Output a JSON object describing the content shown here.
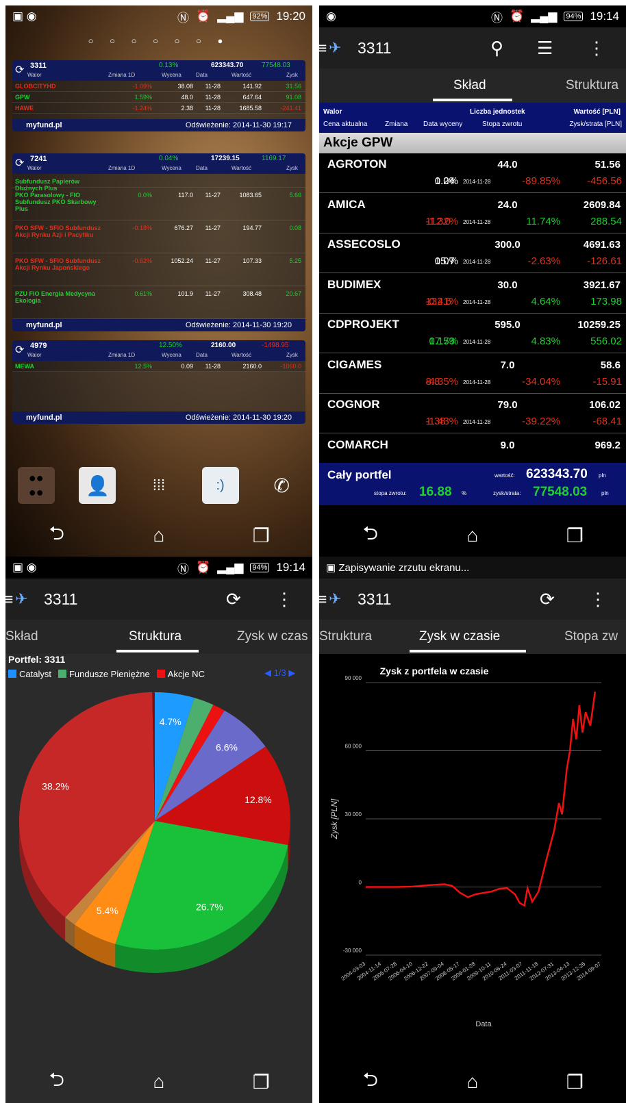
{
  "s1": {
    "status_time": "19:20",
    "battery": "92%",
    "page_dots": "○ ○ ○ ○ ○ ○ ●",
    "widgets": [
      {
        "id": "3311",
        "change": "0.13%",
        "value": "623343.70",
        "profit": "77548.03",
        "headers": [
          "Walor",
          "Zmiana 1D",
          "Wycena",
          "Data",
          "Wartość",
          "Zysk"
        ],
        "rows": [
          {
            "name": "GLOBCITYHD",
            "chg": "-1.09%",
            "val": "38.08",
            "date": "11-28",
            "worth": "141.92",
            "gain": "31.56",
            "nc": "rd",
            "cc": "rd",
            "gc": "g"
          },
          {
            "name": "GPW",
            "chg": "1.59%",
            "val": "48.0",
            "date": "11-28",
            "worth": "647.64",
            "gain": "91.08",
            "nc": "g",
            "cc": "g",
            "gc": "g"
          },
          {
            "name": "HAWE",
            "chg": "-1.24%",
            "val": "2.38",
            "date": "11-28",
            "worth": "1685.58",
            "gain": "-241.41",
            "nc": "rd",
            "cc": "rd",
            "gc": "rd"
          }
        ],
        "footer_brand": "myfund.pl",
        "footer_refresh": "Odświeżenie: 2014-11-30 19:17"
      },
      {
        "id": "7241",
        "change": "0.04%",
        "value": "17239.15",
        "profit": "1169.17",
        "headers": [
          "Walor",
          "Zmiana 1D",
          "Wycena",
          "Data",
          "Wartość",
          "Zysk"
        ],
        "rows": [
          {
            "name": "Subfundusz Papierów Dłużnych Plus",
            "chg": "",
            "val": "",
            "date": "",
            "worth": "",
            "gain": "",
            "nc": "g",
            "cc": "g",
            "gc": "g"
          },
          {
            "name": "PKO Parasolowy - FIO Subfundusz PKO Skarbowy Plus",
            "chg": "0.0%",
            "val": "117.0",
            "date": "11-27",
            "worth": "1083.65",
            "gain": "5.66",
            "nc": "g",
            "cc": "g",
            "gc": "g"
          },
          {
            "name": "PKO SFW - SFIO Subfundusz Akcji Rynku Azji i Pacyfiku",
            "chg": "-0.18%",
            "val": "676.27",
            "date": "11-27",
            "worth": "194.77",
            "gain": "0.08",
            "nc": "rd",
            "cc": "rd",
            "gc": "g"
          },
          {
            "name": "PKO SFW - SFIO Subfundusz Akcji Rynku Japońskiego",
            "chg": "-0.62%",
            "val": "1052.24",
            "date": "11-27",
            "worth": "107.33",
            "gain": "5.25",
            "nc": "rd",
            "cc": "rd",
            "gc": "g"
          },
          {
            "name": "PZU FIO Energia Medycyna Ekologia",
            "chg": "0.61%",
            "val": "101.9",
            "date": "11-27",
            "worth": "308.48",
            "gain": "20.67",
            "nc": "g",
            "cc": "g",
            "gc": "g"
          }
        ],
        "footer_brand": "myfund.pl",
        "footer_refresh": "Odświeżenie: 2014-11-30 19:20"
      },
      {
        "id": "4979",
        "change": "12.50%",
        "value": "2160.00",
        "profit": "-1498.95",
        "headers": [
          "Walor",
          "Zmiana 1D",
          "Wycena",
          "Data",
          "Wartość",
          "Zysk"
        ],
        "rows": [
          {
            "name": "MEWA",
            "chg": "12.5%",
            "val": "0.09",
            "date": "11-28",
            "worth": "2160.0",
            "gain": "-1060.0",
            "nc": "g",
            "cc": "g",
            "gc": "rd"
          }
        ],
        "footer_brand": "myfund.pl",
        "footer_refresh": "Odświeżenie: 2014-11-30 19:20"
      }
    ]
  },
  "s2": {
    "status_time": "19:14",
    "battery": "94%",
    "title": "3311",
    "tabs": [
      "Skład",
      "Struktura"
    ],
    "header": {
      "walor": "Walor",
      "units": "Liczba jednostek",
      "worth": "Wartość [PLN]",
      "price": "Cena aktualna",
      "chg": "Zmiana",
      "date": "Data wyceny",
      "rate": "Stopa zwrotu",
      "pl": "Zysk/strata [PLN]"
    },
    "group": "Akcje GPW",
    "rows": [
      {
        "name": "AGROTON",
        "qty": "44.0",
        "worth": "51.56",
        "price": "1.24",
        "chg": "0.0%",
        "date": "2014-11-28",
        "rate": "-89.85%",
        "pl": "-456.56",
        "pc": "wh",
        "rc": "rd"
      },
      {
        "name": "AMICA",
        "qty": "24.0",
        "worth": "2609.84",
        "price": "112.0",
        "chg": "-1.32%",
        "date": "2014-11-28",
        "rate": "11.74%",
        "pl": "288.54",
        "pc": "rd",
        "rc": "g"
      },
      {
        "name": "ASSECOSLO",
        "qty": "300.0",
        "worth": "4691.63",
        "price": "15.7",
        "chg": "0.0%",
        "date": "2014-11-28",
        "rate": "-2.63%",
        "pl": "-126.61",
        "pc": "wh",
        "rc": "rd"
      },
      {
        "name": "BUDIMEX",
        "qty": "30.0",
        "worth": "3921.67",
        "price": "132.6",
        "chg": "-0.41%",
        "date": "2014-11-28",
        "rate": "4.64%",
        "pl": "173.98",
        "pc": "rd",
        "rc": "g"
      },
      {
        "name": "CDPROJEKT",
        "qty": "595.0",
        "worth": "10259.25",
        "price": "17.53",
        "chg": "0.17%",
        "date": "2014-11-28",
        "rate": "4.83%",
        "pl": "556.02",
        "pc": "g",
        "rc": "g"
      },
      {
        "name": "CIGAMES",
        "qty": "7.0",
        "worth": "58.6",
        "price": "8.8",
        "chg": "-4.35%",
        "date": "2014-11-28",
        "rate": "-34.04%",
        "pl": "-15.91",
        "pc": "rd",
        "rc": "rd"
      },
      {
        "name": "COGNOR",
        "qty": "79.0",
        "worth": "106.02",
        "price": "1.38",
        "chg": "-1.43%",
        "date": "2014-11-28",
        "rate": "-39.22%",
        "pl": "-68.41",
        "pc": "rd",
        "rc": "rd"
      },
      {
        "name": "COMARCH",
        "qty": "9.0",
        "worth": "969.2",
        "price": "",
        "chg": "",
        "date": "",
        "rate": "",
        "pl": "",
        "pc": "rd",
        "rc": "rd"
      }
    ],
    "total": {
      "label": "Cały portfel",
      "worth_label": "wartość:",
      "worth": "623343.70",
      "unit": "pln",
      "rate_label": "stopa zwrotu:",
      "rate": "16.88",
      "rate_unit": "%",
      "pl_label": "zysk/strata:",
      "pl": "77548.03",
      "pl_unit": "pln"
    }
  },
  "s3": {
    "status_time": "19:14",
    "battery": "94%",
    "title": "3311",
    "tabs": [
      "Skład",
      "Struktura",
      "Zysk w czas"
    ],
    "portfolio": "Portfel: 3311",
    "legend": [
      {
        "name": "Catalyst",
        "color": "#1e90ff"
      },
      {
        "name": "Fundusze Pieniężne",
        "color": "#4caf6e"
      },
      {
        "name": "Akcje NC",
        "color": "#ee1111"
      }
    ],
    "pager": "1/3",
    "chart_data": {
      "type": "pie",
      "slices": [
        {
          "value": 4.7,
          "color": "#1e9bff",
          "label": "4.7%"
        },
        {
          "value": 2.4,
          "color": "#4caf6e",
          "label": ""
        },
        {
          "value": 1.5,
          "color": "#ee1111",
          "label": ""
        },
        {
          "value": 6.6,
          "color": "#6a6acb",
          "label": "6.6%"
        },
        {
          "value": 12.8,
          "color": "#cc0e0e",
          "label": "12.8%"
        },
        {
          "value": 26.7,
          "color": "#19c13a",
          "label": "26.7%"
        },
        {
          "value": 5.4,
          "color": "#ff8c14",
          "label": "5.4%"
        },
        {
          "value": 1.4,
          "color": "#c4843e",
          "label": ""
        },
        {
          "value": 38.2,
          "color": "#c62828",
          "label": "38.2%"
        },
        {
          "value": 0.3,
          "color": "#7a1010",
          "label": ""
        }
      ]
    }
  },
  "s4": {
    "status_msg": "Zapisywanie zrzutu ekranu...",
    "title": "3311",
    "tabs": [
      "Struktura",
      "Zysk w czasie",
      "Stopa zw"
    ],
    "chart_data": {
      "type": "line",
      "title": "Zysk z portfela w czasie",
      "ylabel": "Zysk [PLN]",
      "xlabel": "Data",
      "ylim": [
        -30000,
        90000
      ],
      "yticks": [
        "90 000",
        "60 000",
        "30 000",
        "0",
        "-30 000"
      ],
      "xticks": [
        "2004-03-03",
        "2004-11-14",
        "2005-07-28",
        "2006-04-10",
        "2006-12-22",
        "2007-09-04",
        "2008-05-17",
        "2009-01-28",
        "2009-10-11",
        "2010-06-24",
        "2011-03-07",
        "2011-11-18",
        "2012-07-31",
        "2013-04-13",
        "2013-12-25",
        "2014-09-07"
      ],
      "series": [
        {
          "color": "#ee1111",
          "points": [
            [
              0,
              0
            ],
            [
              1,
              0
            ],
            [
              2,
              0
            ],
            [
              3,
              200
            ],
            [
              4,
              800
            ],
            [
              5,
              1200
            ],
            [
              5.5,
              500
            ],
            [
              6,
              -2500
            ],
            [
              6.5,
              -4500
            ],
            [
              7,
              -3200
            ],
            [
              8,
              -2000
            ],
            [
              8.5,
              -800
            ],
            [
              9,
              -500
            ],
            [
              9.5,
              -3200
            ],
            [
              9.8,
              -7000
            ],
            [
              10.1,
              -8200
            ],
            [
              10.3,
              -500
            ],
            [
              10.6,
              -6500
            ],
            [
              11,
              -2000
            ],
            [
              11.5,
              12000
            ],
            [
              12,
              25000
            ],
            [
              12.3,
              37000
            ],
            [
              12.5,
              32000
            ],
            [
              12.8,
              52000
            ],
            [
              13,
              60000
            ],
            [
              13.2,
              74000
            ],
            [
              13.4,
              65000
            ],
            [
              13.6,
              80000
            ],
            [
              13.8,
              68000
            ],
            [
              14,
              77000
            ],
            [
              14.3,
              71000
            ],
            [
              14.6,
              86000
            ]
          ]
        }
      ]
    }
  }
}
